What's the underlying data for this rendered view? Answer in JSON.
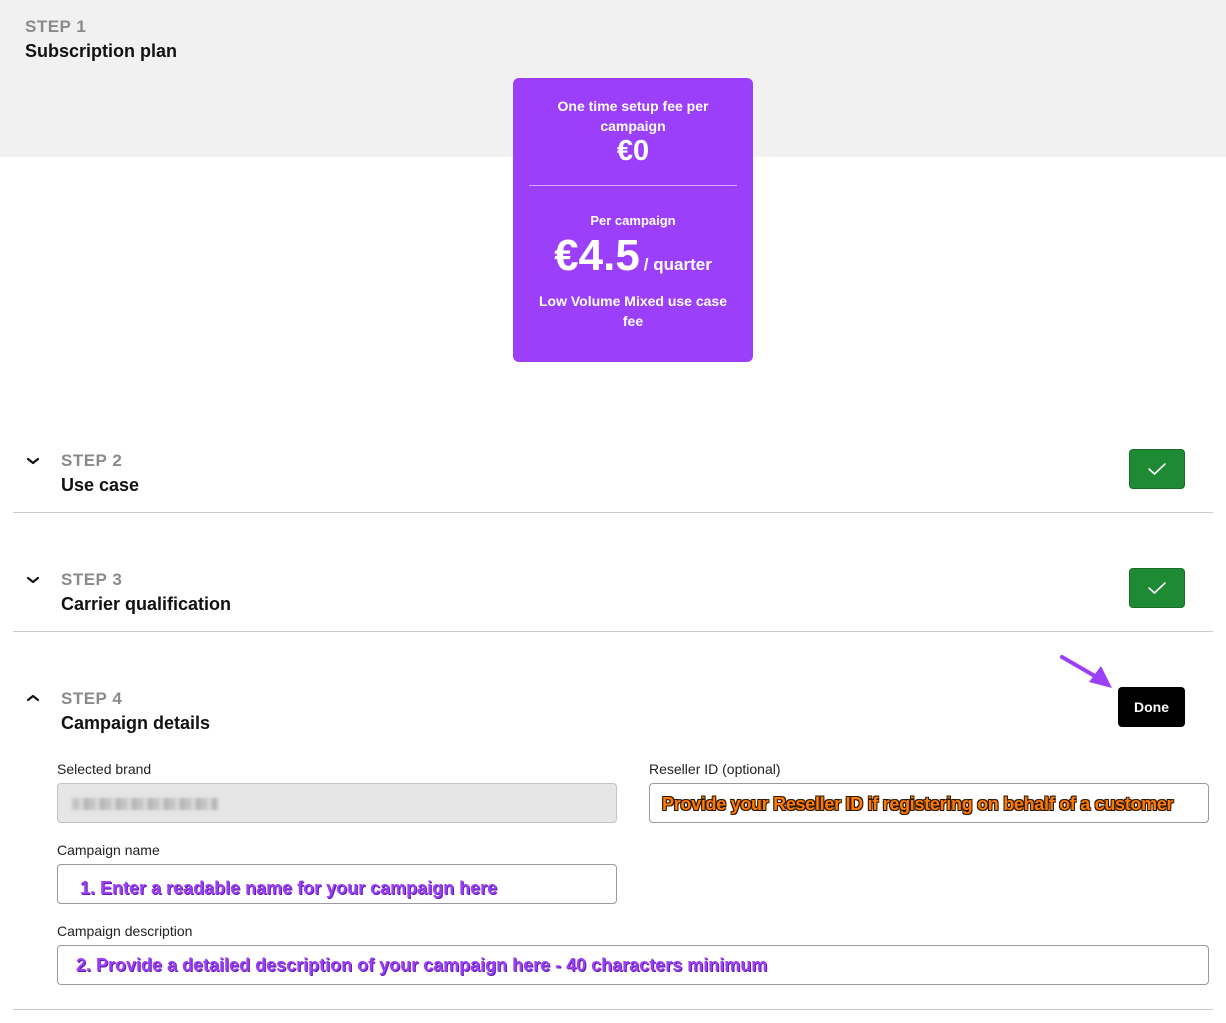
{
  "step1": {
    "number": "STEP 1",
    "title": "Subscription plan",
    "plan": {
      "setup_label": "One time setup fee per campaign",
      "setup_price": "€0",
      "per_label": "Per campaign",
      "price": "€4.5",
      "per_period": "/ quarter",
      "fee_label": "Low Volume Mixed use case fee",
      "color": "#9b3ffa"
    }
  },
  "step2": {
    "number": "STEP 2",
    "title": "Use case",
    "status": "complete",
    "chevron": "chevron-down-icon"
  },
  "step3": {
    "number": "STEP 3",
    "title": "Carrier qualification",
    "status": "complete",
    "chevron": "chevron-down-icon"
  },
  "step4": {
    "number": "STEP 4",
    "title": "Campaign details",
    "chevron": "chevron-up-icon",
    "done_label": "Done",
    "fields": {
      "selected_brand": {
        "label": "Selected brand"
      },
      "reseller_id": {
        "label": "Reseller ID (optional)",
        "annotation": "Provide your Reseller ID if registering on behalf of a customer"
      },
      "campaign_name": {
        "label": "Campaign name",
        "annotation": "1. Enter a readable name for your campaign here"
      },
      "campaign_description": {
        "label": "Campaign description",
        "annotation": "2. Provide a detailed description of your campaign here - 40 characters minimum"
      }
    }
  },
  "colors": {
    "accent": "#9b3ffa",
    "success": "#1e8a34",
    "annotation_orange": "#ff7a00"
  }
}
